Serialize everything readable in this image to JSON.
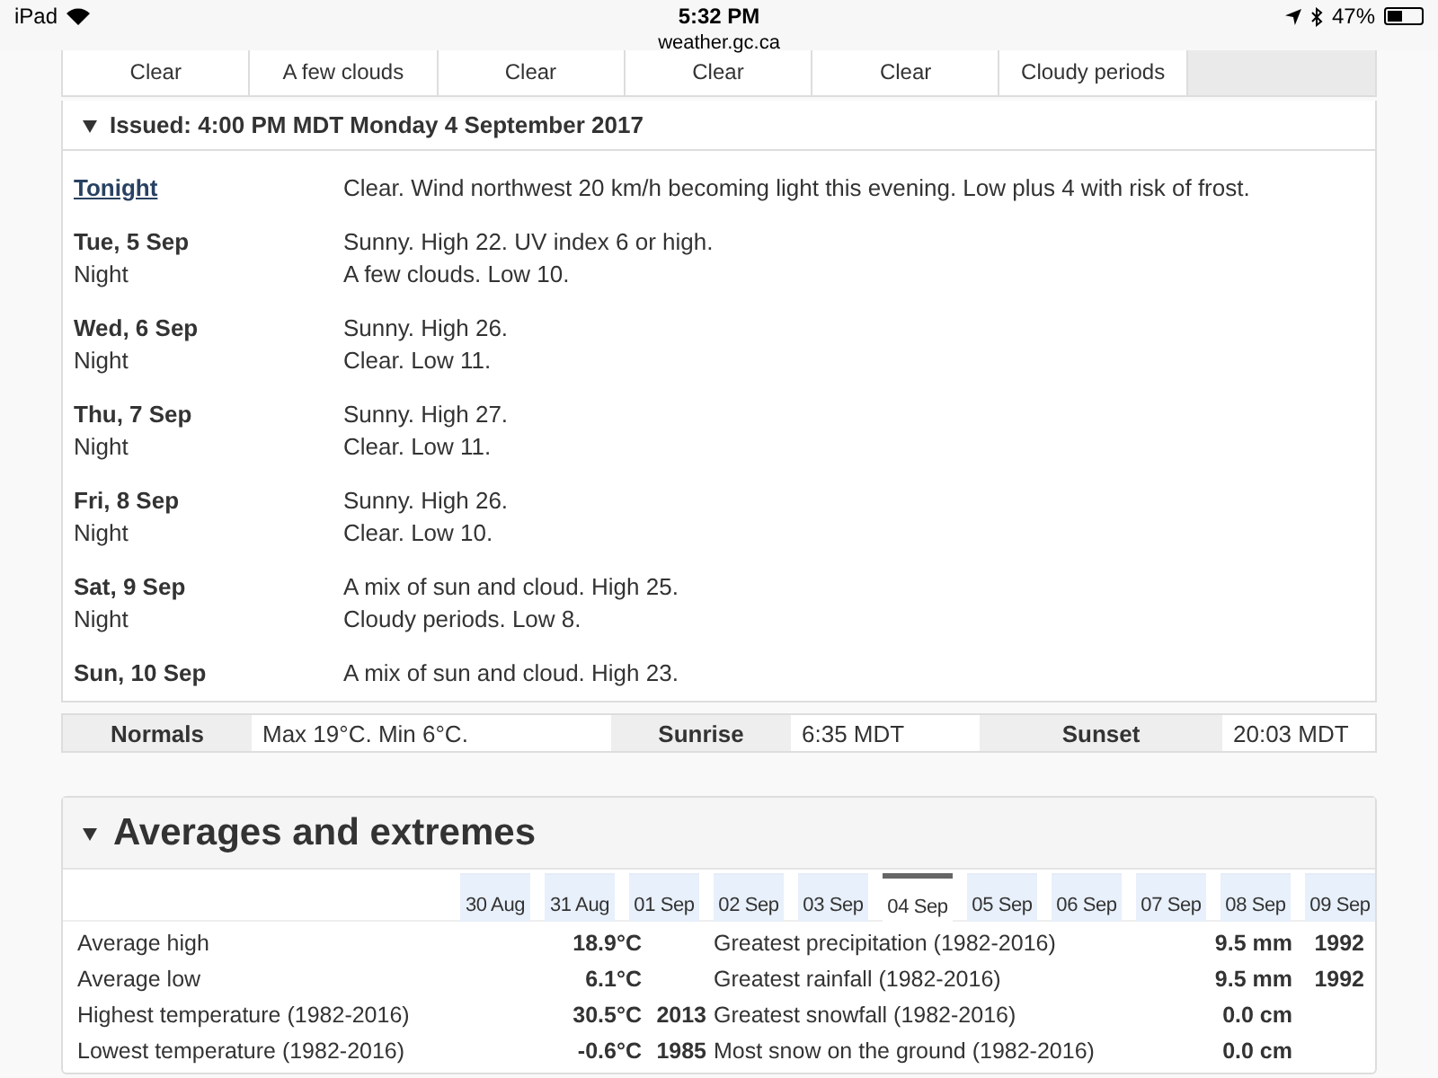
{
  "status_bar": {
    "device": "iPad",
    "time": "5:32 PM",
    "battery": "47%",
    "url": "weather.gc.ca"
  },
  "conditions_row": [
    {
      "text": "Clear"
    },
    {
      "text": "A few clouds"
    },
    {
      "text": "Clear"
    },
    {
      "text": "Clear"
    },
    {
      "text": "Clear"
    },
    {
      "text": "Cloudy periods"
    }
  ],
  "forecast": {
    "issued": "Issued: 4:00 PM MDT Monday 4 September 2017",
    "expanded": true,
    "periods": [
      {
        "kind": "link",
        "label": "Tonight",
        "text": "Clear. Wind northwest 20 km/h becoming light this evening. Low plus 4 with risk of frost."
      },
      {
        "kind": "day",
        "label": "Tue, 5 Sep",
        "text": "Sunny. High 22. UV index 6 or high."
      },
      {
        "kind": "night",
        "label": "Night",
        "text": "A few clouds. Low 10."
      },
      {
        "kind": "day",
        "label": "Wed, 6 Sep",
        "text": "Sunny. High 26."
      },
      {
        "kind": "night",
        "label": "Night",
        "text": "Clear. Low 11."
      },
      {
        "kind": "day",
        "label": "Thu, 7 Sep",
        "text": "Sunny. High 27."
      },
      {
        "kind": "night",
        "label": "Night",
        "text": "Clear. Low 11."
      },
      {
        "kind": "day",
        "label": "Fri, 8 Sep",
        "text": "Sunny. High 26."
      },
      {
        "kind": "night",
        "label": "Night",
        "text": "Clear. Low 10."
      },
      {
        "kind": "day",
        "label": "Sat, 9 Sep",
        "text": "A mix of sun and cloud. High 25."
      },
      {
        "kind": "night",
        "label": "Night",
        "text": "Cloudy periods. Low 8."
      },
      {
        "kind": "day",
        "label": "Sun, 10 Sep",
        "text": "A mix of sun and cloud. High 23."
      }
    ]
  },
  "normals": [
    {
      "label": "Normals",
      "value": "Max 19°C. Min 6°C."
    },
    {
      "label": "Sunrise",
      "value": "6:35 MDT"
    },
    {
      "label": "Sunset",
      "value": "20:03 MDT"
    }
  ],
  "averages": {
    "title": "Averages and extremes",
    "expanded": true,
    "dates": [
      {
        "label": "30 Aug",
        "selected": false
      },
      {
        "label": "31 Aug",
        "selected": false
      },
      {
        "label": "01 Sep",
        "selected": false
      },
      {
        "label": "02 Sep",
        "selected": false
      },
      {
        "label": "03 Sep",
        "selected": false
      },
      {
        "label": "04 Sep",
        "selected": true
      },
      {
        "label": "05 Sep",
        "selected": false
      },
      {
        "label": "06 Sep",
        "selected": false
      },
      {
        "label": "07 Sep",
        "selected": false
      },
      {
        "label": "08 Sep",
        "selected": false
      },
      {
        "label": "09 Sep",
        "selected": false
      }
    ],
    "left_rows": [
      {
        "label": "Average high",
        "value": "18.9°C"
      },
      {
        "label": "Average low",
        "value": "6.1°C"
      },
      {
        "label": "Highest temperature (1982-2016)",
        "value": "30.5°C",
        "year": "2013"
      },
      {
        "label": "Lowest temperature (1982-2016)",
        "value": "-0.6°C",
        "year": "1985"
      }
    ],
    "right_rows": [
      {
        "label": "Greatest precipitation (1982-2016)",
        "value": "9.5 mm",
        "year": "1992"
      },
      {
        "label": "Greatest rainfall (1982-2016)",
        "value": "9.5 mm",
        "year": "1992"
      },
      {
        "label": "Greatest snowfall (1982-2016)",
        "value": "0.0 cm"
      },
      {
        "label": "Most snow on the ground (1982-2016)",
        "value": "0.0 cm"
      }
    ]
  }
}
